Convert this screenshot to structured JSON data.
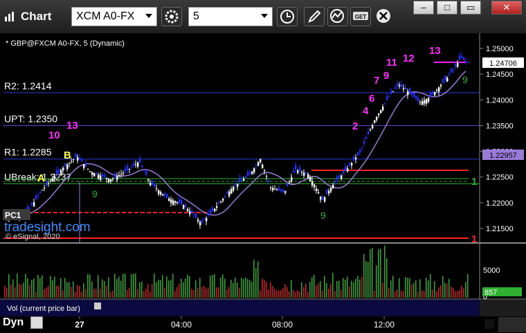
{
  "window": {
    "title": "Chart",
    "symbol_value": "XCM A0-FX",
    "interval_value": "5",
    "buttons": {
      "minimize": "–",
      "maximize": "□",
      "close": "✕"
    },
    "toolbar_icons": [
      "gear-icon",
      "clock-icon",
      "pencil-icon",
      "indicator-icon",
      "get-icon",
      "close-circle-icon"
    ]
  },
  "chart_header": "* GBP@FXCM A0-FX, 5 (Dynamic)",
  "watermark": {
    "brand": "tradesight.com",
    "copyright": "© eSignal, 2020"
  },
  "price_axis": {
    "ticks": [
      "1.25000",
      "1.24500",
      "1.24000",
      "1.23500",
      "1.23000",
      "1.22500",
      "1.22000",
      "1.21500"
    ],
    "last_price": "1.24706",
    "ma_label": "1.22957"
  },
  "levels": [
    {
      "label": "R2: 1.2414",
      "value": 1.2414,
      "color": "#2c3cd8"
    },
    {
      "label": "UPT: 1.2350",
      "value": 1.235,
      "color": "#6a4ad8"
    },
    {
      "label": "R1: 1.2285",
      "value": 1.2285,
      "color": "#2c3cd8"
    },
    {
      "label": "UBreak: 1.2237",
      "value": 1.2237,
      "color": "#30b030"
    }
  ],
  "markers": {
    "a": "A",
    "b": "B",
    "r_one": "1",
    "g_one": "1",
    "pc": "PC1"
  },
  "counts_magenta": [
    "10",
    "13",
    "2",
    "4",
    "7",
    "9",
    "11",
    "12",
    "13",
    "6"
  ],
  "counts_green": [
    "9",
    "9",
    "9"
  ],
  "volume": {
    "label": "Vol (current price bar)",
    "ticks": [
      "5000",
      "0"
    ],
    "last": "857"
  },
  "time_axis": {
    "labels": [
      "27",
      "04:00",
      "08:00",
      "12:00"
    ]
  },
  "footer": {
    "mode": "Dyn"
  },
  "colors": {
    "up": "#ffffff",
    "down": "#2030ff",
    "vol_up": "#2fa02f",
    "vol_down": "#c02020",
    "ma": "#9a7ad8",
    "count": "#ff2cff",
    "green_count": "#30b030"
  }
}
